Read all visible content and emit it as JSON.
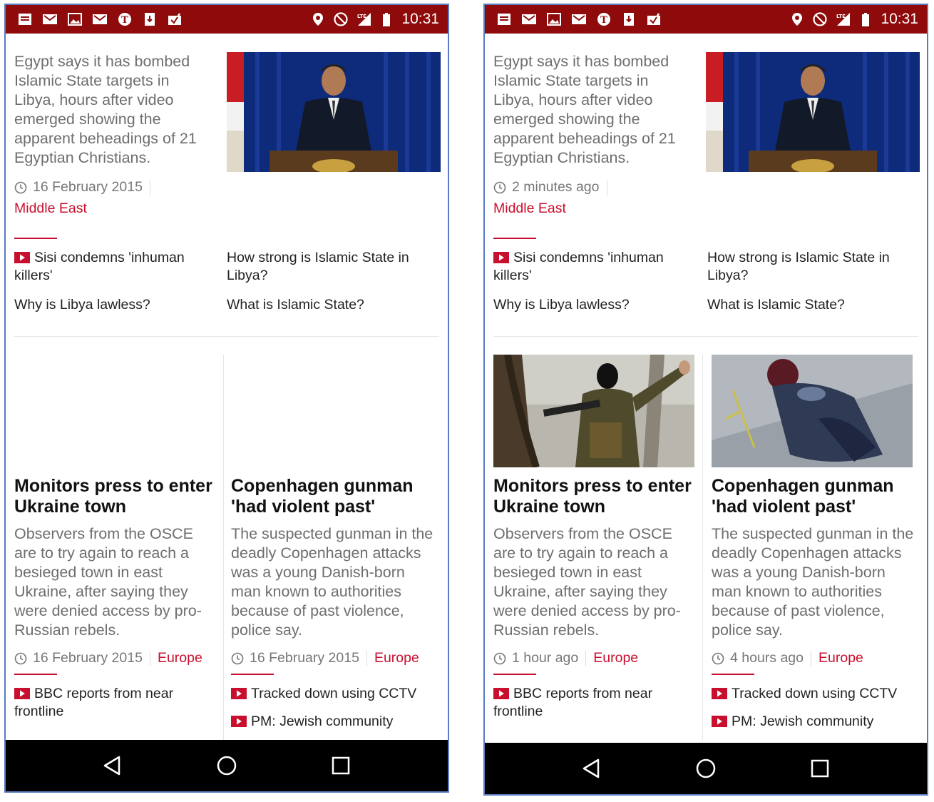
{
  "status_bar": {
    "time": "10:31",
    "network": "LTE"
  },
  "screens": [
    {
      "id": "before",
      "lead": {
        "summary": "Egypt says it has bombed Islamic State targets in Libya, hours after video emerged showing the apparent beheadings of 21 Egyptian Christians.",
        "timestamp": "16 February 2015",
        "section": "Middle East",
        "related": [
          "Sisi condemns 'inhuman killers'",
          "How strong is Islamic State in Libya?",
          "Why is Libya lawless?",
          "What is Islamic State?"
        ]
      },
      "cards": [
        {
          "headline": "Monitors press to enter Ukraine town",
          "summary": "Observers from the OSCE are to try again to reach a besieged town in east Ukraine, after saying they were denied access by pro-Russian rebels.",
          "timestamp": "16 February 2015",
          "section": "Europe",
          "related": [
            "BBC reports from near frontline"
          ],
          "image_loaded": false
        },
        {
          "headline": "Copenhagen gunman 'had violent past'",
          "summary": "The suspected gunman in the deadly Copenhagen attacks was a young Danish-born man known to authorities because of past violence, police say.",
          "timestamp": "16 February 2015",
          "section": "Europe",
          "related": [
            "Tracked down using CCTV",
            "PM: Jewish community"
          ],
          "image_loaded": false
        }
      ]
    },
    {
      "id": "after",
      "lead": {
        "summary": "Egypt says it has bombed Islamic State targets in Libya, hours after video emerged showing the apparent beheadings of 21 Egyptian Christians.",
        "timestamp": "2 minutes ago",
        "section": "Middle East",
        "related": [
          "Sisi condemns 'inhuman killers'",
          "How strong is Islamic State in Libya?",
          "Why is Libya lawless?",
          "What is Islamic State?"
        ]
      },
      "cards": [
        {
          "headline": "Monitors press to enter Ukraine town",
          "summary": "Observers from the OSCE are to try again to reach a besieged town in east Ukraine, after saying they were denied access by pro-Russian rebels.",
          "timestamp": "1 hour ago",
          "section": "Europe",
          "related": [
            "BBC reports from near frontline"
          ],
          "image_loaded": true
        },
        {
          "headline": "Copenhagen gunman 'had violent past'",
          "summary": "The suspected gunman in the deadly Copenhagen attacks was a young Danish-born man known to authorities because of past violence, police say.",
          "timestamp": "4 hours ago",
          "section": "Europe",
          "related": [
            "Tracked down using CCTV",
            "PM: Jewish community"
          ],
          "image_loaded": true
        }
      ]
    }
  ],
  "colors": {
    "status_bar": "#8f0a0a",
    "accent_red": "#c8102e",
    "nav_bar": "#000000",
    "frame_blue": "#5b7bc0"
  },
  "icons": [
    "notification-icons",
    "location-icon",
    "do-not-disturb-icon",
    "lte-signal-icon",
    "battery-icon",
    "clock-icon",
    "play-video-icon",
    "back-icon",
    "home-icon",
    "recents-icon"
  ]
}
